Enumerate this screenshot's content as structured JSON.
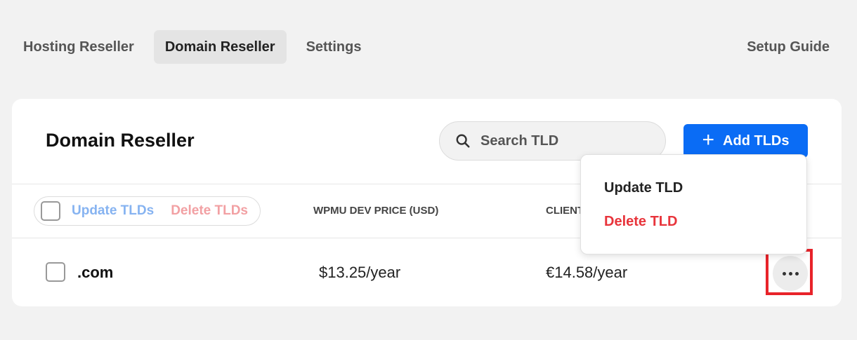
{
  "nav": {
    "tabs": [
      {
        "label": "Hosting Reseller"
      },
      {
        "label": "Domain Reseller"
      },
      {
        "label": "Settings"
      }
    ],
    "setup_guide": "Setup Guide"
  },
  "card": {
    "title": "Domain Reseller",
    "search": {
      "placeholder": "Search TLD",
      "icon": "search-icon"
    },
    "add_button": {
      "label": "Add TLDs",
      "icon": "plus-icon"
    },
    "bulk_actions": {
      "update": "Update TLDs",
      "delete": "Delete TLDs"
    },
    "columns": {
      "wpmu_price": "WPMU DEV PRICE (USD)",
      "client": "CLIENT"
    },
    "rows": [
      {
        "tld": ".com",
        "wpmu_price": "$13.25/year",
        "client_price": "€14.58/year"
      }
    ],
    "menu": {
      "update": "Update TLD",
      "delete": "Delete TLD"
    }
  },
  "colors": {
    "accent": "#0a6cf5",
    "danger": "#e8343b",
    "highlight": "#e8232a"
  }
}
